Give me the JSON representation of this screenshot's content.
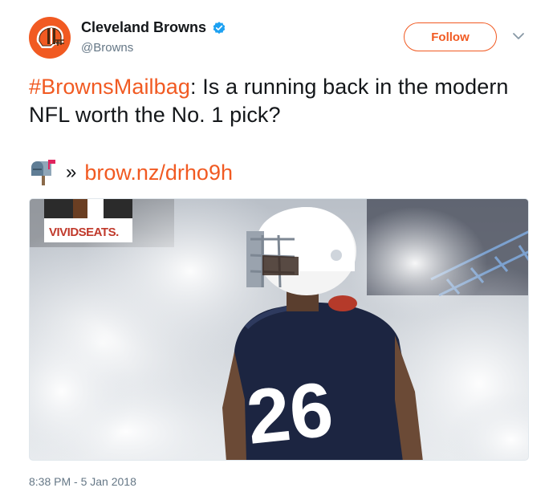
{
  "account": {
    "display_name": "Cleveland Browns",
    "handle": "@Browns",
    "verified": true,
    "avatar_icon": "browns-helmet-icon",
    "brand_color": "#f15a22"
  },
  "actions": {
    "follow_label": "Follow",
    "more_icon": "chevron-down-icon"
  },
  "tweet": {
    "hashtag": "#BrownsMailbag",
    "text": ": Is a running back in the modern NFL worth the No. 1 pick?",
    "link_prefix_icon": "mailbox-icon",
    "link_separator": "»",
    "link_url": "brow.nz/drho9h"
  },
  "media": {
    "sponsor_logo": "VIVIDSEATS.",
    "jersey_number": "26",
    "description_icon": "photo"
  },
  "timestamp": "8:38 PM - 5 Jan 2018"
}
